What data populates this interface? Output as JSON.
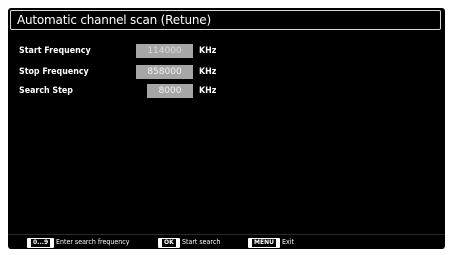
{
  "screen": {
    "title": "Automatic channel scan (Retune)"
  },
  "settings": [
    {
      "label": "Start Frequency",
      "value": "114000",
      "unit": "KHz"
    },
    {
      "label": "Stop Frequency",
      "value": "858000",
      "unit": "KHz"
    },
    {
      "label": "Search Step",
      "value": "8000",
      "unit": "KHz"
    }
  ],
  "footer": {
    "hints": [
      {
        "key": "0...9",
        "text": "Enter search frequency"
      },
      {
        "key": "OK",
        "text": "Start search"
      },
      {
        "key": "MENU",
        "text": "Exit"
      }
    ]
  },
  "colors": {
    "background": "#000000",
    "value_box": "#a6a6a6",
    "text": "#ffffff"
  }
}
